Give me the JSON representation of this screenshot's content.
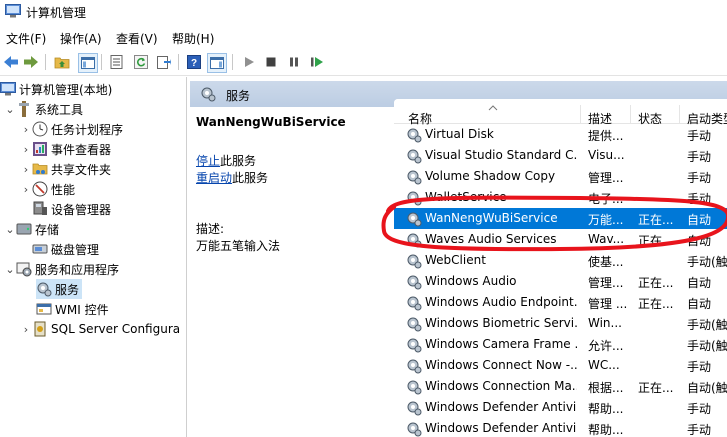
{
  "window": {
    "title": "计算机管理"
  },
  "menu": [
    "文件(F)",
    "操作(A)",
    "查看(V)",
    "帮助(H)"
  ],
  "tree": {
    "root": "计算机管理(本地)",
    "system_tools": "系统工具",
    "task_scheduler": "任务计划程序",
    "event_viewer": "事件查看器",
    "shared_folders": "共享文件夹",
    "performance": "性能",
    "device_manager": "设备管理器",
    "storage": "存储",
    "disk_management": "磁盘管理",
    "services_apps": "服务和应用程序",
    "services": "服务",
    "wmi": "WMI 控件",
    "sql": "SQL Server Configura"
  },
  "panel": {
    "header": "服务",
    "selected_service": "WanNengWuBiService",
    "stop_link": "停止",
    "stop_suffix": "此服务",
    "restart_link": "重启动",
    "restart_suffix": "此服务",
    "desc_label": "描述:",
    "desc_text": "万能五笔输入法"
  },
  "columns": {
    "name": "名称",
    "desc": "描述",
    "status": "状态",
    "startup": "启动类型"
  },
  "services": [
    {
      "name": "Virtual Disk",
      "desc": "提供...",
      "status": "",
      "startup": "手动"
    },
    {
      "name": "Visual Studio Standard C...",
      "desc": "Visu...",
      "status": "",
      "startup": "手动"
    },
    {
      "name": "Volume Shadow Copy",
      "desc": "管理...",
      "status": "",
      "startup": "手动"
    },
    {
      "name": "WalletService",
      "desc": "电子...",
      "status": "",
      "startup": "手动"
    },
    {
      "name": "WanNengWuBiService",
      "desc": "万能...",
      "status": "正在...",
      "startup": "自动"
    },
    {
      "name": "Waves Audio Services",
      "desc": "Wav...",
      "status": "正在...",
      "startup": "自动"
    },
    {
      "name": "WebClient",
      "desc": "使基...",
      "status": "",
      "startup": "手动(触发"
    },
    {
      "name": "Windows Audio",
      "desc": "管理...",
      "status": "正在...",
      "startup": "自动"
    },
    {
      "name": "Windows Audio Endpoint...",
      "desc": "管理 ...",
      "status": "正在...",
      "startup": "自动"
    },
    {
      "name": "Windows Biometric Servi...",
      "desc": "Win...",
      "status": "",
      "startup": "手动(触发"
    },
    {
      "name": "Windows Camera Frame ...",
      "desc": "允许...",
      "status": "",
      "startup": "手动(触发"
    },
    {
      "name": "Windows Connect Now -...",
      "desc": "WC...",
      "status": "",
      "startup": "手动"
    },
    {
      "name": "Windows Connection Ma...",
      "desc": "根据...",
      "status": "正在...",
      "startup": "自动(触发"
    },
    {
      "name": "Windows Defender Antivi...",
      "desc": "帮助...",
      "status": "",
      "startup": "手动"
    },
    {
      "name": "Windows Defender Antivi...",
      "desc": "帮助...",
      "status": "",
      "startup": "手动"
    }
  ],
  "selected_index": 4,
  "colors": {
    "selection": "#0078d7",
    "header_band": "#ccd9ea",
    "highlight_circle": "#e8141c"
  }
}
